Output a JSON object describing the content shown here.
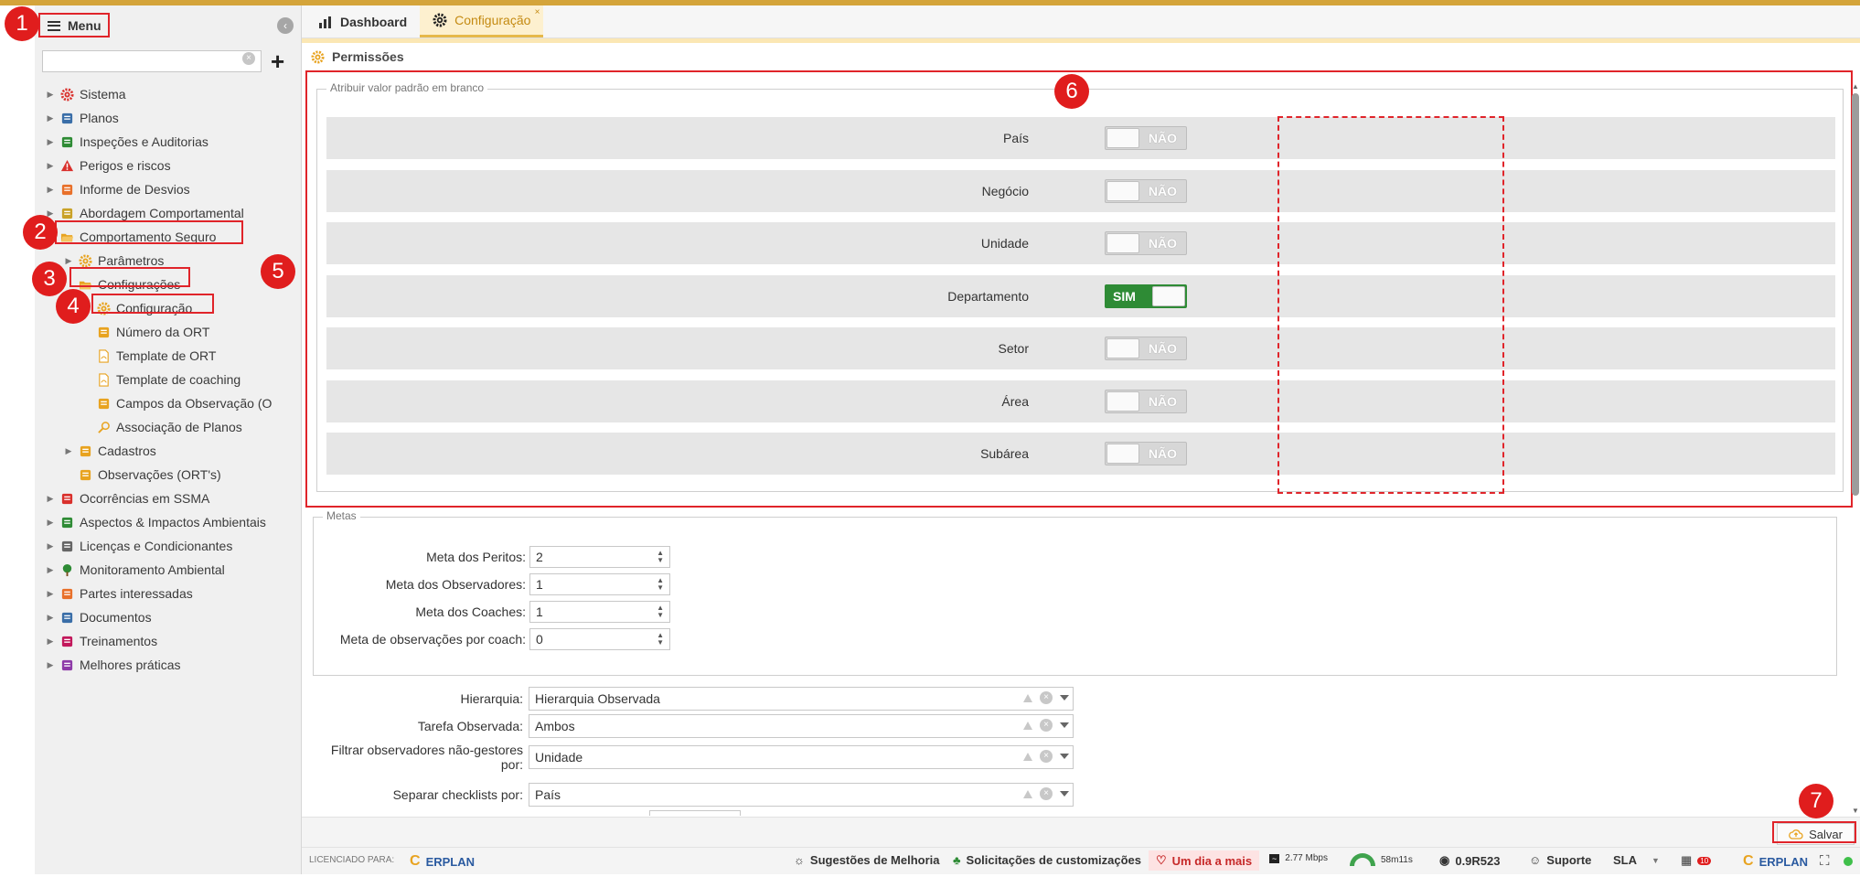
{
  "sidebar": {
    "menu_label": "Menu",
    "search_value": "",
    "items": [
      {
        "label": "Sistema",
        "icon": "gear-red-icon",
        "level": 0,
        "arrow": "▶"
      },
      {
        "label": "Planos",
        "icon": "calendar-icon",
        "level": 0,
        "arrow": "▶"
      },
      {
        "label": "Inspeções e Auditorias",
        "icon": "checklist-icon",
        "level": 0,
        "arrow": "▶"
      },
      {
        "label": "Perigos e riscos",
        "icon": "warning-icon",
        "level": 0,
        "arrow": "▶"
      },
      {
        "label": "Informe de Desvios",
        "icon": "deviation-icon",
        "level": 0,
        "arrow": "▶"
      },
      {
        "label": "Abordagem Comportamental",
        "icon": "helmet-icon",
        "level": 0,
        "arrow": "▶"
      },
      {
        "label": "Comportamento Seguro",
        "icon": "folder-open-icon",
        "level": 0,
        "arrow": ""
      },
      {
        "label": "Parâmetros",
        "icon": "gear-icon",
        "level": 1,
        "arrow": "▶"
      },
      {
        "label": "Configurações",
        "icon": "folder-open-icon",
        "level": 1,
        "arrow": ""
      },
      {
        "label": "Configuração",
        "icon": "gear-icon",
        "level": 2,
        "arrow": ""
      },
      {
        "label": "Número da ORT",
        "icon": "numbering-icon",
        "level": 2,
        "arrow": ""
      },
      {
        "label": "Template de ORT",
        "icon": "pdf-icon",
        "level": 2,
        "arrow": ""
      },
      {
        "label": "Template de coaching",
        "icon": "pdf-icon",
        "level": 2,
        "arrow": ""
      },
      {
        "label": "Campos da Observação (O",
        "icon": "fields-icon",
        "level": 2,
        "arrow": ""
      },
      {
        "label": "Associação de Planos",
        "icon": "search-icon",
        "level": 2,
        "arrow": ""
      },
      {
        "label": "Cadastros",
        "icon": "people-icon",
        "level": 1,
        "arrow": "▶"
      },
      {
        "label": "Observações (ORT's)",
        "icon": "edit-icon",
        "level": 1,
        "arrow": ""
      },
      {
        "label": "Ocorrências em SSMA",
        "icon": "person-fall-icon",
        "level": 0,
        "arrow": "▶"
      },
      {
        "label": "Aspectos & Impactos Ambientais",
        "icon": "recycle-icon",
        "level": 0,
        "arrow": "▶"
      },
      {
        "label": "Licenças e Condicionantes",
        "icon": "license-icon",
        "level": 0,
        "arrow": "▶"
      },
      {
        "label": "Monitoramento Ambiental",
        "icon": "tree-icon",
        "level": 0,
        "arrow": "▶"
      },
      {
        "label": "Partes interessadas",
        "icon": "people-orange-icon",
        "level": 0,
        "arrow": "▶"
      },
      {
        "label": "Documentos",
        "icon": "documents-icon",
        "level": 0,
        "arrow": "▶"
      },
      {
        "label": "Treinamentos",
        "icon": "trainer-icon",
        "level": 0,
        "arrow": "▶"
      },
      {
        "label": "Melhores práticas",
        "icon": "medal-icon",
        "level": 0,
        "arrow": "▶"
      }
    ]
  },
  "tabs": [
    {
      "label": "Dashboard",
      "icon": "bar-chart-icon",
      "active": false
    },
    {
      "label": "Configuração",
      "icon": "gear-icon",
      "active": true,
      "close": "×"
    }
  ],
  "section": {
    "title": "Permissões"
  },
  "permissions": {
    "legend": "Atribuir valor padrão em branco",
    "rows": [
      {
        "label": "País",
        "value": "NÃO",
        "on": false
      },
      {
        "label": "Negócio",
        "value": "NÃO",
        "on": false
      },
      {
        "label": "Unidade",
        "value": "NÃO",
        "on": false
      },
      {
        "label": "Departamento",
        "value": "SIM",
        "on": true
      },
      {
        "label": "Setor",
        "value": "NÃO",
        "on": false
      },
      {
        "label": "Área",
        "value": "NÃO",
        "on": false
      },
      {
        "label": "Subárea",
        "value": "NÃO",
        "on": false
      }
    ]
  },
  "metas": {
    "legend": "Metas",
    "fields": [
      {
        "label": "Meta dos Peritos:",
        "value": "2"
      },
      {
        "label": "Meta dos Observadores:",
        "value": "1"
      },
      {
        "label": "Meta dos Coaches:",
        "value": "1"
      },
      {
        "label": "Meta de observações por coach:",
        "value": "0"
      }
    ]
  },
  "selects": [
    {
      "label": "Hierarquia:",
      "value": "Hierarquia Observada"
    },
    {
      "label": "Tarefa Observada:",
      "value": "Ambos"
    },
    {
      "label_line1": "Filtrar observadores não-gestores",
      "label_line2": "por:",
      "value": "Unidade"
    },
    {
      "label": "Separar checklists por:",
      "value": "País"
    }
  ],
  "save_label": "Salvar",
  "footer": {
    "licensed_for": "LICENCIADO PARA:",
    "brand_left": "ERPLAN",
    "suggestions": "Sugestões de Melhoria",
    "customizations": "Solicitações de customizações",
    "one_more_day": "Um dia a mais",
    "speed": "2.77 Mbps",
    "session": "58m11s",
    "version": "0.9R523",
    "support": "Suporte",
    "sla": "SLA",
    "badge_count": "10",
    "brand_right": "ERPLAN"
  },
  "badges": [
    "1",
    "2",
    "3",
    "4",
    "5",
    "6",
    "7"
  ],
  "colors": {
    "accent": "#d4a43a",
    "highlight_red": "#e0242a",
    "toggle_on": "#2e8b35"
  }
}
